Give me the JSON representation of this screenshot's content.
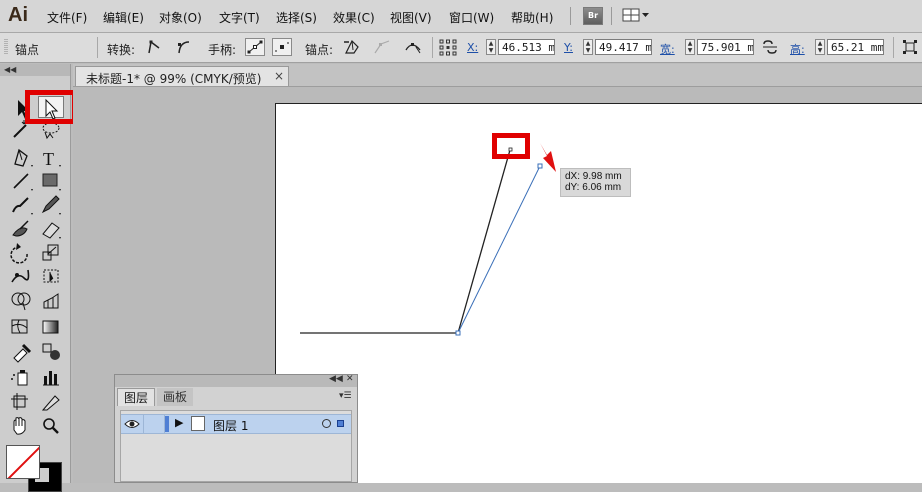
{
  "app": {
    "logo": "Ai",
    "menu": [
      "文件(F)",
      "编辑(E)",
      "对象(O)",
      "文字(T)",
      "选择(S)",
      "效果(C)",
      "视图(V)",
      "窗口(W)",
      "帮助(H)"
    ],
    "bridge_label": "Br"
  },
  "control_bar": {
    "mode_label": "锚点",
    "convert_label": "转换:",
    "handles_label": "手柄:",
    "anchor_label": "锚点:",
    "x_label": "X:",
    "x_value": "46.513 mm",
    "y_label": "Y:",
    "y_value": "49.417 mm",
    "w_label": "宽:",
    "w_value": "75.901 mm",
    "h_label": "高:",
    "h_value": "65.21 mm"
  },
  "document": {
    "tab_title": "未标题-1* @ 99% (CMYK/预览)",
    "close_glyph": "×"
  },
  "canvas": {
    "tooltip_dx": "dX: 9.98 mm",
    "tooltip_dy": "dY: 6.06 mm",
    "highlight_color": "#e00000",
    "selection_color": "#3a6fb8"
  },
  "layers_panel": {
    "tab_layers": "图层",
    "tab_artboards": "画板",
    "layer_name": "图层 1",
    "layer_color": "#4f7fd4"
  },
  "toolbar": {
    "tools": [
      "selection",
      "direct-selection",
      "magic-wand",
      "lasso",
      "pen",
      "type",
      "line",
      "rectangle",
      "paintbrush",
      "pencil",
      "blob-brush",
      "eraser",
      "rotate",
      "scale",
      "warp",
      "free-transform",
      "shape-builder",
      "perspective-grid",
      "mesh",
      "gradient",
      "eyedropper",
      "blend",
      "symbol-sprayer",
      "column-graph",
      "artboard",
      "slice",
      "hand",
      "zoom"
    ]
  }
}
